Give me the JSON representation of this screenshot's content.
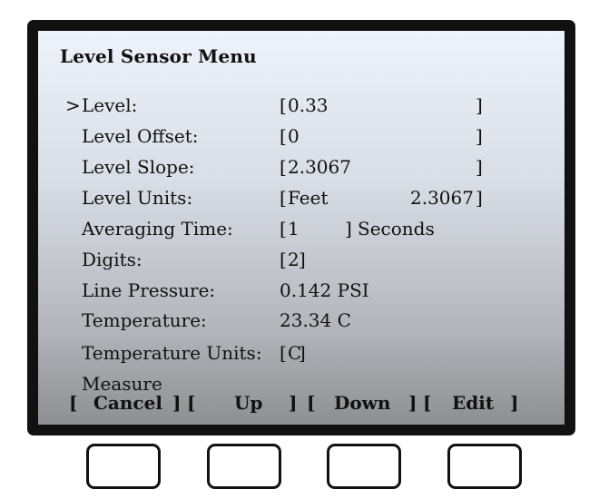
{
  "screen": {
    "title": "Level Sensor Menu",
    "cursor": ">",
    "rows": [
      {
        "label": "Level:",
        "value": "0.33",
        "bracketed": true
      },
      {
        "label": "Level Offset:",
        "value": "0",
        "bracketed": true
      },
      {
        "label": "Level Slope:",
        "value": "2.3067",
        "bracketed": true
      },
      {
        "label": "Level Units:",
        "value": "Feet",
        "value_right": "2.3067",
        "bracketed": true
      },
      {
        "label": "Averaging Time:",
        "value": "1",
        "suffix": "Seconds",
        "bracketed": true
      },
      {
        "label": "Digits:",
        "value": "2",
        "bracketed": true
      },
      {
        "label": "Line Pressure:",
        "value": "0.142 PSI",
        "bracketed": false
      },
      {
        "label": "Temperature:",
        "value": "23.34 C",
        "bracketed": false
      },
      {
        "label": "Temperature Units:",
        "value": "C",
        "bracketed": true
      },
      {
        "label": "Measure",
        "partially_hidden": true
      }
    ],
    "selected_row": 0
  },
  "brackets": {
    "open": "[",
    "close": "]"
  },
  "softkeys": [
    {
      "label": "Cancel"
    },
    {
      "label": "Up"
    },
    {
      "label": "Down"
    },
    {
      "label": "Edit"
    }
  ],
  "hardware_buttons": 4,
  "colors": {
    "frame": "#111111",
    "screen_top": "#eef2fa",
    "screen_bottom": "#8e8f92",
    "text": "#111111"
  }
}
